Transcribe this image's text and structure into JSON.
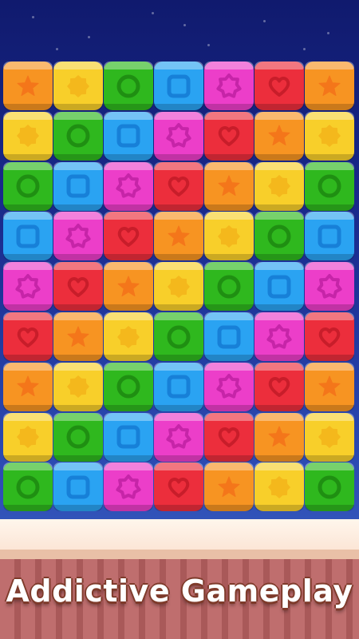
{
  "tagline": "Addictive Gameplay",
  "palette": {
    "orange": {
      "body": "#f79422",
      "emb": "#f4761a"
    },
    "yellow": {
      "body": "#f8cf2a",
      "emb": "#f4b81c"
    },
    "green": {
      "body": "#2fb81e",
      "emb": "#1f8f12"
    },
    "blue": {
      "body": "#2aa3f2",
      "emb": "#1780d8"
    },
    "pink": {
      "body": "#ec3ec9",
      "emb": "#c624a8"
    },
    "red": {
      "body": "#ec2e3c",
      "emb": "#c81d2a"
    }
  },
  "board": {
    "rows": [
      [
        "orange-star",
        "yellow-sun",
        "green-circle",
        "blue-square",
        "pink-badge",
        "red-heart",
        "orange-star"
      ],
      [
        "yellow-sun",
        "green-circle",
        "blue-square",
        "pink-badge",
        "red-heart",
        "orange-star",
        "yellow-sun"
      ],
      [
        "green-circle",
        "blue-square",
        "pink-badge",
        "red-heart",
        "orange-star",
        "yellow-sun",
        "green-circle"
      ],
      [
        "blue-square",
        "pink-badge",
        "red-heart",
        "orange-star",
        "yellow-sun",
        "green-circle",
        "blue-square"
      ],
      [
        "pink-badge",
        "red-heart",
        "orange-star",
        "yellow-sun",
        "green-circle",
        "blue-square",
        "pink-badge"
      ],
      [
        "red-heart",
        "orange-star",
        "yellow-sun",
        "green-circle",
        "blue-square",
        "pink-badge",
        "red-heart"
      ],
      [
        "orange-star",
        "yellow-sun",
        "green-circle",
        "blue-square",
        "pink-badge",
        "red-heart",
        "orange-star"
      ],
      [
        "yellow-sun",
        "green-circle",
        "blue-square",
        "pink-badge",
        "red-heart",
        "orange-star",
        "yellow-sun"
      ],
      [
        "green-circle",
        "blue-square",
        "pink-badge",
        "red-heart",
        "orange-star",
        "yellow-sun",
        "green-circle"
      ]
    ]
  }
}
